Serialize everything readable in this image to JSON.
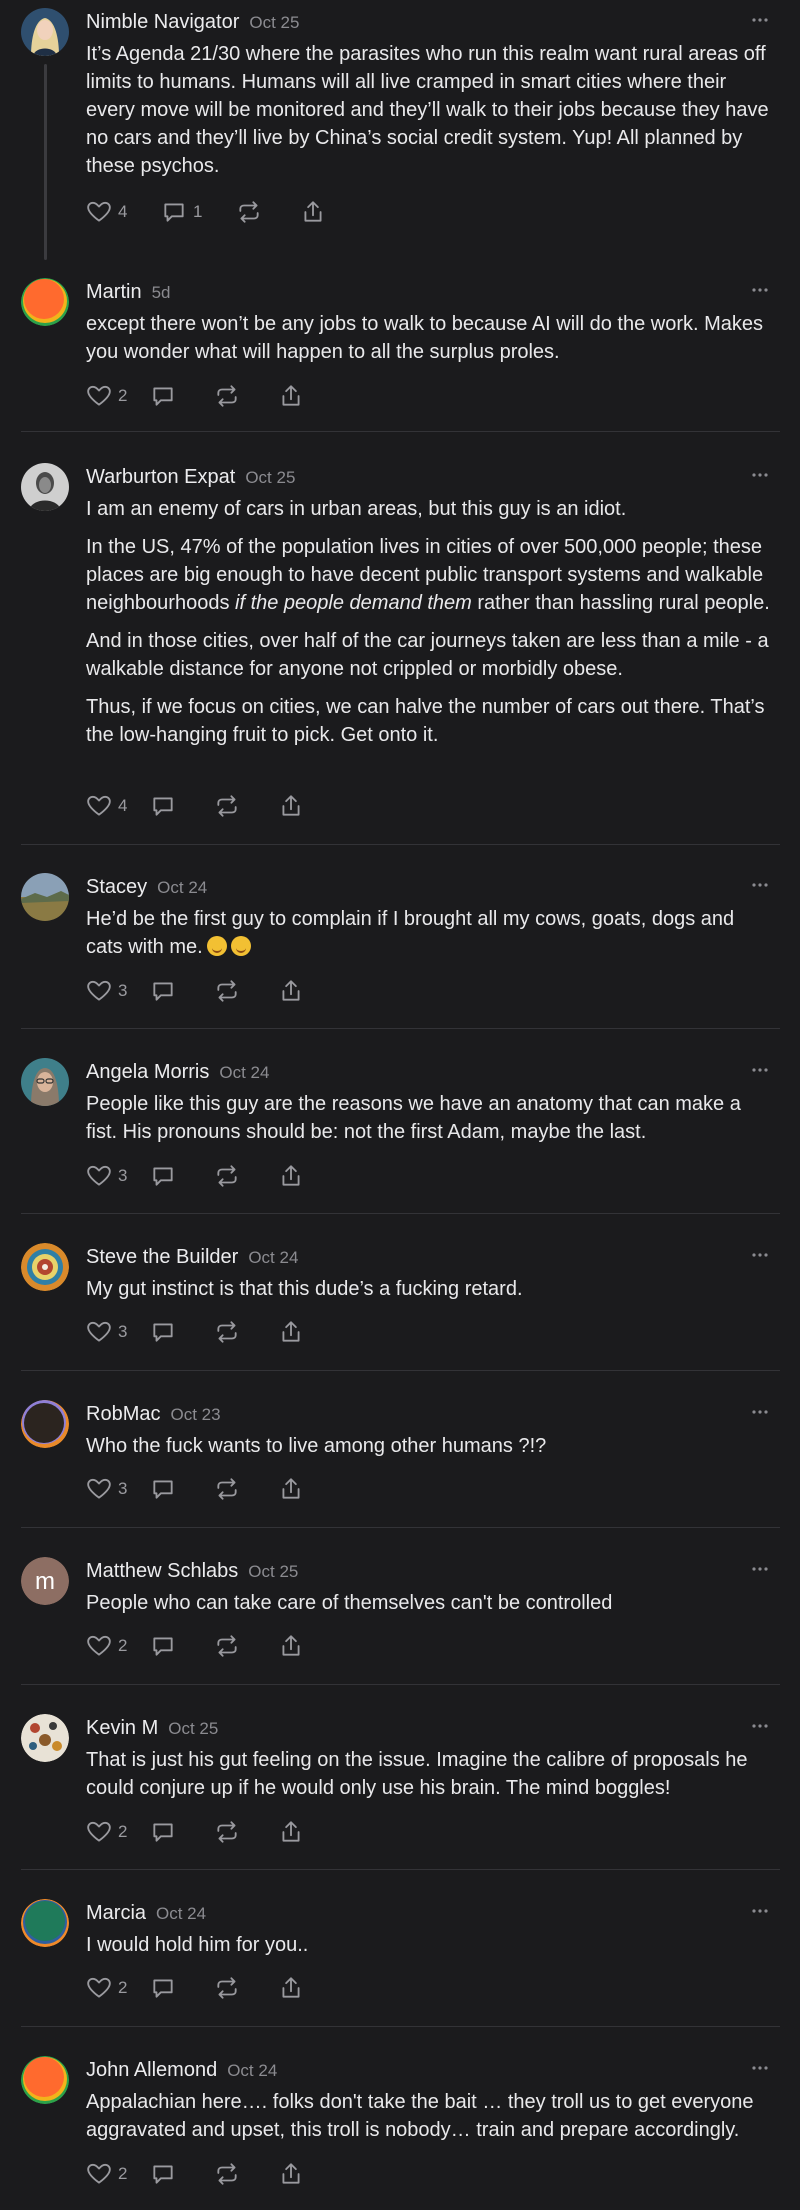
{
  "comments": [
    {
      "author": "Nimble Navigator",
      "date": "Oct 25",
      "paragraphs": [
        "It’s Agenda 21/30 where the parasites who run this realm want rural areas off limits to humans. Humans will all live cramped in smart cities where their every move will be monitored and they’ll walk to their jobs because they have no cars and they’ll live by China’s social credit system. Yup! All planned by these psychos."
      ],
      "likes": "4",
      "replies": "1",
      "avatar_icon": "portrait-blonde-woman",
      "colors": {
        "a": "#d9c9a3",
        "b": "#2f4f6f"
      }
    },
    {
      "author": "Martin",
      "date": "5d",
      "paragraphs": [
        "except there won’t be any jobs to walk to because AI will do the work. Makes you wonder what will happen to all the surplus proles."
      ],
      "likes": "2",
      "replies": "",
      "avatar_icon": "gradient-orange-green",
      "colors": {
        "a": "#ff6a2e",
        "b": "#2ca24a"
      }
    },
    {
      "author": "Warburton Expat",
      "date": "Oct 25",
      "paragraphs": [
        "I am an enemy of cars in urban areas, but this guy is an idiot.",
        "In the US, 47% of the population lives in cities of over 500,000 people; these places are big enough to have decent public transport systems and walkable neighbourhoods if the people demand them rather than hassling rural people.",
        "And in those cities, over half of the car journeys taken are less than a mile - a walkable distance for anyone not crippled or morbidly obese.",
        "Thus, if we focus on cities, we can halve the number of cars out there. That’s the low-hanging fruit to pick. Get onto it."
      ],
      "italic_phrase": "if the people demand them",
      "likes": "4",
      "replies": "",
      "avatar_icon": "portrait-bw-man",
      "colors": {
        "a": "#bdbdbd",
        "b": "#3a3a3a"
      }
    },
    {
      "author": "Stacey",
      "date": "Oct 24",
      "paragraphs": [
        "He’d be the first guy to complain if I brought all my cows, goats, dogs and cats with me."
      ],
      "likes": "3",
      "replies": "",
      "avatar_icon": "landscape-field",
      "colors": {
        "a": "#7a8fa6",
        "b": "#7a6a3a"
      }
    },
    {
      "author": "Angela Morris",
      "date": "Oct 24",
      "paragraphs": [
        "People like this guy are the reasons we have an anatomy that can make a fist. His pronouns should be: not the first Adam, maybe the last."
      ],
      "likes": "3",
      "replies": "",
      "avatar_icon": "portrait-woman-glasses",
      "colors": {
        "a": "#3f7f8a",
        "b": "#c9a48c"
      }
    },
    {
      "author": "Steve the Builder",
      "date": "Oct 24",
      "paragraphs": [
        "My gut instinct is that this dude’s a fucking retard."
      ],
      "likes": "3",
      "replies": "",
      "avatar_icon": "mandala",
      "colors": {
        "a": "#d98a2b",
        "b": "#2f7fa6"
      }
    },
    {
      "author": "RobMac",
      "date": "Oct 23",
      "paragraphs": [
        "Who the fuck wants to live among other humans ?!?"
      ],
      "likes": "3",
      "replies": "",
      "avatar_icon": "gradient-dark-orange",
      "colors": {
        "a": "#2b241f",
        "b": "#e98a2a"
      }
    },
    {
      "author": "Matthew Schlabs",
      "date": "Oct 25",
      "paragraphs": [
        "People who can take care of themselves can't be controlled"
      ],
      "likes": "2",
      "replies": "",
      "avatar_icon": "letter-m",
      "avatar_letter": "m",
      "colors": {
        "a": "#8d6e63",
        "b": "#ffffff"
      }
    },
    {
      "author": "Kevin M",
      "date": "Oct 25",
      "paragraphs": [
        "That is just his gut feeling on the issue. Imagine the calibre of proposals he could conjure up if he would only use his brain. The mind boggles!"
      ],
      "likes": "2",
      "replies": "",
      "avatar_icon": "pattern-collage",
      "colors": {
        "a": "#e8e2d6",
        "b": "#b2452f"
      }
    },
    {
      "author": "Marcia",
      "date": "Oct 24",
      "paragraphs": [
        "I would hold him for you.."
      ],
      "likes": "2",
      "replies": "",
      "avatar_icon": "gradient-green-orange",
      "colors": {
        "a": "#1f7a5a",
        "b": "#f08a2a"
      }
    },
    {
      "author": "John Allemond",
      "date": "Oct 24",
      "paragraphs": [
        "Appalachian here…. folks don't take the bait … they troll us to get everyone aggravated and upset, this troll is nobody… train and prepare accordingly."
      ],
      "likes": "2",
      "replies": "",
      "avatar_icon": "gradient-orange-green",
      "colors": {
        "a": "#ff6a2e",
        "b": "#2ca24a"
      }
    }
  ]
}
